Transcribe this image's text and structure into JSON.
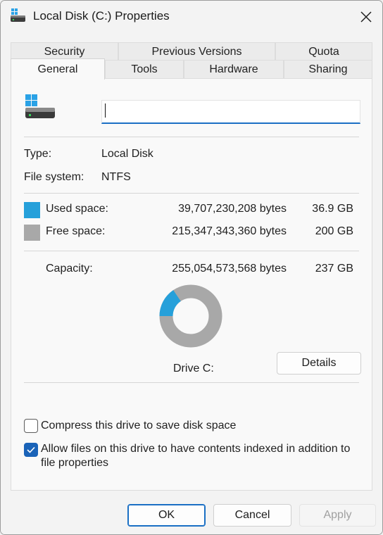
{
  "window": {
    "title": "Local Disk (C:) Properties",
    "close_icon": "close-icon"
  },
  "tabs": {
    "row1": [
      "Security",
      "Previous Versions",
      "Quota"
    ],
    "row2": [
      "General",
      "Tools",
      "Hardware",
      "Sharing"
    ],
    "active": "General"
  },
  "general": {
    "drive_icon": "drive-icon",
    "name_value": "",
    "type_label": "Type:",
    "type_value": "Local Disk",
    "fs_label": "File system:",
    "fs_value": "NTFS",
    "used_label": "Used space:",
    "used_bytes": "39,707,230,208 bytes",
    "used_gb": "36.9 GB",
    "free_label": "Free space:",
    "free_bytes": "215,347,343,360 bytes",
    "free_gb": "200 GB",
    "capacity_label": "Capacity:",
    "capacity_bytes": "255,054,573,568 bytes",
    "capacity_gb": "237 GB",
    "drive_label": "Drive C:",
    "details_button": "Details",
    "used_fraction": 0.1557,
    "used_color": "#26a0da",
    "free_color": "#a8a8a8"
  },
  "options": {
    "compress_label": "Compress this drive to save disk space",
    "compress_checked": false,
    "index_label_line1": "Allow files on this drive to have contents indexed in addition to",
    "index_label_line2": "file properties",
    "index_checked": true
  },
  "footer": {
    "ok": "OK",
    "cancel": "Cancel",
    "apply": "Apply"
  }
}
